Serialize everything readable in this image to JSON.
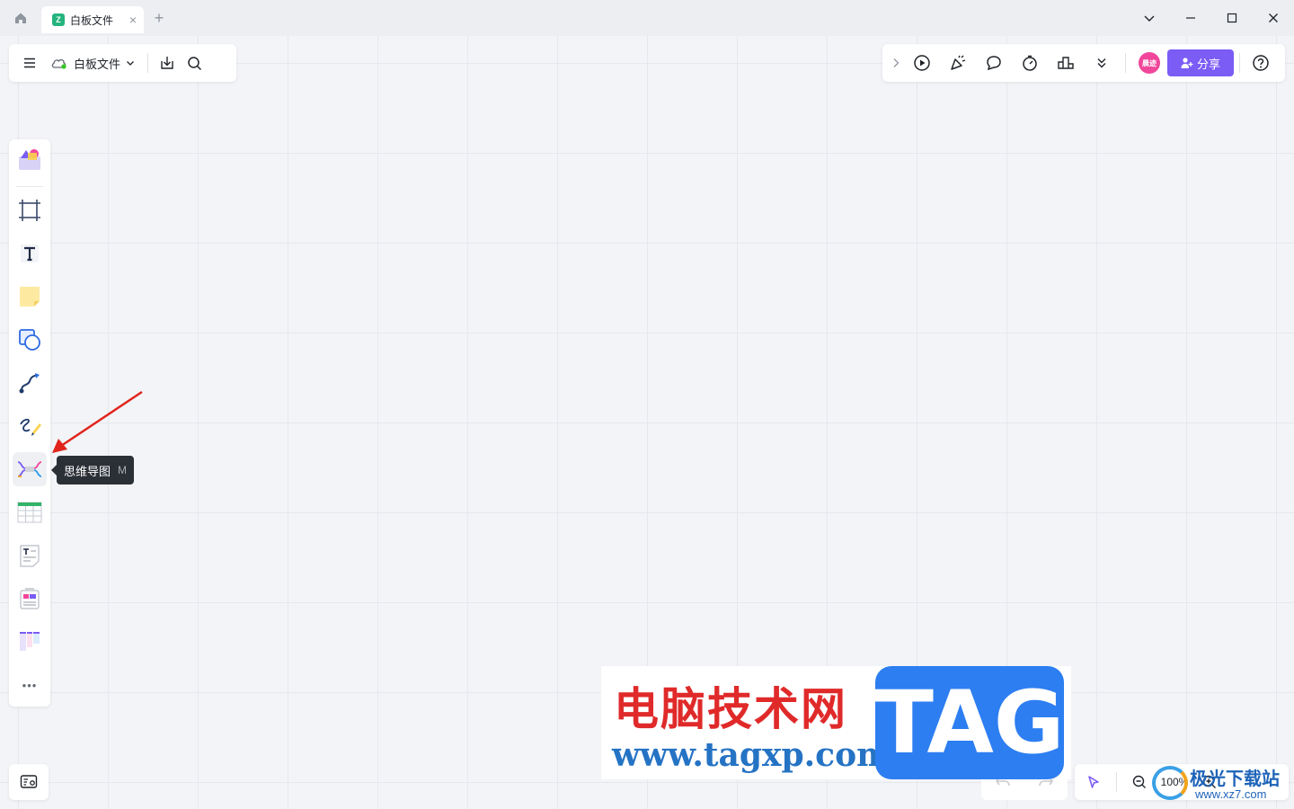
{
  "titlebar": {
    "tab_title": "白板文件",
    "tab_close": "×",
    "new_tab": "+",
    "logo_glyph": "Z"
  },
  "toolbar_left": {
    "doc_name": "白板文件"
  },
  "toolbar_right": {
    "avatar_text": "晨迹",
    "share_label": "分享",
    "accent_color": "#7b5cf5"
  },
  "tool_rail": {
    "tooltip_label": "思维导图",
    "tooltip_shortcut": "M",
    "more_label": "•••"
  },
  "zoom": {
    "value": "100%"
  },
  "watermark": {
    "cn_text": "电脑技术网",
    "url": "www.tagxp.com",
    "tag": "TAG",
    "site2_cn": "极光下载站",
    "site2_url": "www.xz7.com"
  }
}
